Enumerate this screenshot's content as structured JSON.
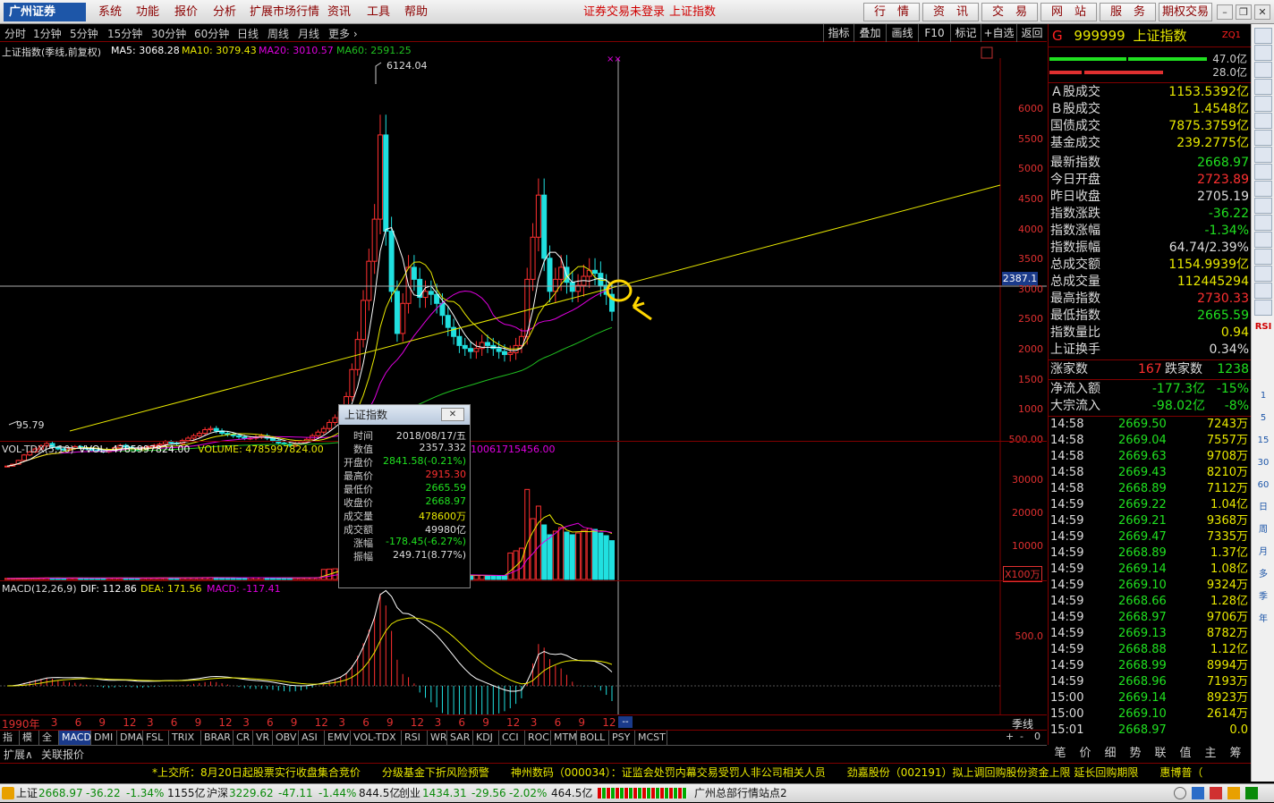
{
  "app": {
    "logo": "广州证券",
    "menu": [
      "系统",
      "功能",
      "报价",
      "分析",
      "扩展市场行情",
      "资讯",
      "工具",
      "帮助"
    ],
    "status_login": "证券交易未登录",
    "status_index": "上证指数",
    "top_buttons": [
      "行　情",
      "资　讯",
      "交　易",
      "网　站",
      "服　务",
      "期权交易"
    ]
  },
  "periods": [
    "分时",
    "1分钟",
    "5分钟",
    "15分钟",
    "30分钟",
    "60分钟",
    "日线",
    "周线",
    "月线",
    "更多 ›"
  ],
  "toolbar": [
    "指标",
    "叠加",
    "画线",
    "F10",
    "标记",
    "+自选",
    "返回"
  ],
  "main_chart": {
    "title": "上证指数(季线,前复权)",
    "ma5": "MA5: 3068.28",
    "ma10": "MA10: 3079.43",
    "ma20": "MA20: 3010.57",
    "ma60": "MA60: 2591.25",
    "high_label": "6124.04",
    "low_label": "95.79",
    "crosshair_value": "2387.1",
    "y_ticks": [
      "6000",
      "5500",
      "5000",
      "4500",
      "4000",
      "3500",
      "3000",
      "2500",
      "2000",
      "1500",
      "1000",
      "500.00"
    ]
  },
  "vol_panel": {
    "title": "VOL-TDX(5,10)",
    "vvol": "VVOL: 4785997824.00",
    "volume": "VOLUME: 4785997824.00",
    "extra": "10061715456.00",
    "y_ticks": [
      "30000",
      "20000",
      "10000"
    ],
    "unit": "X100万"
  },
  "macd_panel": {
    "title": "MACD(12,26,9)",
    "dif": "DIF: 112.86",
    "dea": "DEA: 171.56",
    "macd": "MACD: -117.41",
    "y_ticks": [
      "500.0"
    ]
  },
  "x_axis": {
    "labels": [
      "1990年",
      "3",
      "6",
      "9",
      "12",
      "3",
      "6",
      "9",
      "12",
      "3",
      "6",
      "9",
      "12",
      "3",
      "6",
      "9",
      "12",
      "3",
      "6",
      "9",
      "12",
      "3",
      "6",
      "9",
      "12",
      "3"
    ],
    "period": "季线"
  },
  "popup": {
    "title": "上证指数",
    "rows": [
      {
        "k": "时间",
        "v": "2018/08/17/五",
        "c": "#ddd"
      },
      {
        "k": "数值",
        "v": "2357.332",
        "c": "#ddd"
      },
      {
        "k": "开盘价",
        "v": "2841.58(-0.21%)",
        "c": "#20e020"
      },
      {
        "k": "最高价",
        "v": "2915.30",
        "c": "#ff3030"
      },
      {
        "k": "最低价",
        "v": "2665.59",
        "c": "#20e020"
      },
      {
        "k": "收盘价",
        "v": "2668.97",
        "c": "#20e020"
      },
      {
        "k": "成交量",
        "v": "478600万",
        "c": "#e8e800"
      },
      {
        "k": "成交额",
        "v": "49980亿",
        "c": "#ddd"
      },
      {
        "k": "涨幅",
        "v": "-178.45(-6.27%)",
        "c": "#20e020"
      },
      {
        "k": "振幅",
        "v": "249.71(8.77%)",
        "c": "#ddd"
      }
    ]
  },
  "indicator_tabs": [
    "指标",
    "模板",
    "全部",
    "MACD",
    "DMI",
    "DMA",
    "FSL",
    "TRIX",
    "BRAR",
    "CR",
    "VR",
    "OBV",
    "ASI",
    "EMV",
    "VOL-TDX",
    "RSI",
    "WR",
    "SAR",
    "KDJ",
    "CCI",
    "ROC",
    "MTM",
    "BOLL",
    "PSY",
    "MCST"
  ],
  "bottom_row": [
    "扩展∧",
    "关联报价"
  ],
  "right_panel": {
    "g": "G",
    "code": "999999",
    "name": "上证指数",
    "zq": "ZQ1",
    "bar_vals": [
      "47.0亿",
      "28.0亿"
    ],
    "stats": [
      {
        "k": "Ａ股成交",
        "v": "1153.5392亿",
        "c": "#e8e800"
      },
      {
        "k": "Ｂ股成交",
        "v": "1.4548亿",
        "c": "#e8e800"
      },
      {
        "k": "国债成交",
        "v": "7875.3759亿",
        "c": "#e8e800"
      },
      {
        "k": "基金成交",
        "v": "239.2775亿",
        "c": "#e8e800"
      },
      {
        "k": "最新指数",
        "v": "2668.97",
        "c": "#20e020"
      },
      {
        "k": "今日开盘",
        "v": "2723.89",
        "c": "#ff3030"
      },
      {
        "k": "昨日收盘",
        "v": "2705.19",
        "c": "#ddd"
      },
      {
        "k": "指数涨跌",
        "v": "-36.22",
        "c": "#20e020"
      },
      {
        "k": "指数涨幅",
        "v": "-1.34%",
        "c": "#20e020"
      },
      {
        "k": "指数振幅",
        "v": "64.74/2.39%",
        "c": "#ddd"
      },
      {
        "k": "总成交额",
        "v": "1154.9939亿",
        "c": "#e8e800"
      },
      {
        "k": "总成交量",
        "v": "112445294",
        "c": "#e8e800"
      },
      {
        "k": "最高指数",
        "v": "2730.33",
        "c": "#ff3030"
      },
      {
        "k": "最低指数",
        "v": "2665.59",
        "c": "#20e020"
      },
      {
        "k": "指数量比",
        "v": "0.94",
        "c": "#e8e800"
      },
      {
        "k": "上证换手",
        "v": "0.34%",
        "c": "#ddd"
      }
    ],
    "updown": {
      "k1": "涨家数",
      "v1": "167",
      "k2": "跌家数",
      "v2": "1238"
    },
    "flow": [
      {
        "k": "净流入额",
        "v": "-177.3亿",
        "p": "-15%"
      },
      {
        "k": "大宗流入",
        "v": "-98.02亿",
        "p": "-8%"
      }
    ],
    "ticks": [
      {
        "t": "14:58",
        "p": "2669.50",
        "q": "7243万"
      },
      {
        "t": "14:58",
        "p": "2669.04",
        "q": "7557万"
      },
      {
        "t": "14:58",
        "p": "2669.63",
        "q": "9708万"
      },
      {
        "t": "14:58",
        "p": "2669.43",
        "q": "8210万"
      },
      {
        "t": "14:58",
        "p": "2668.89",
        "q": "7112万"
      },
      {
        "t": "14:59",
        "p": "2669.22",
        "q": "1.04亿"
      },
      {
        "t": "14:59",
        "p": "2669.21",
        "q": "9368万"
      },
      {
        "t": "14:59",
        "p": "2669.47",
        "q": "7335万"
      },
      {
        "t": "14:59",
        "p": "2668.89",
        "q": "1.37亿"
      },
      {
        "t": "14:59",
        "p": "2669.14",
        "q": "1.08亿"
      },
      {
        "t": "14:59",
        "p": "2669.10",
        "q": "9324万"
      },
      {
        "t": "14:59",
        "p": "2668.66",
        "q": "1.28亿"
      },
      {
        "t": "14:59",
        "p": "2668.97",
        "q": "9706万"
      },
      {
        "t": "14:59",
        "p": "2669.13",
        "q": "8782万"
      },
      {
        "t": "14:59",
        "p": "2668.88",
        "q": "1.12亿"
      },
      {
        "t": "14:59",
        "p": "2668.99",
        "q": "8994万"
      },
      {
        "t": "14:59",
        "p": "2668.96",
        "q": "7193万"
      },
      {
        "t": "15:00",
        "p": "2669.14",
        "q": "8923万"
      },
      {
        "t": "15:00",
        "p": "2669.10",
        "q": "2614万"
      },
      {
        "t": "15:01",
        "p": "2668.97",
        "q": "0.0"
      }
    ],
    "tabs": [
      "笔",
      "价",
      "细",
      "势",
      "联",
      "值",
      "主",
      "筹"
    ]
  },
  "sidebar_labels": [
    "RSI",
    "1",
    "5",
    "15",
    "30",
    "60",
    "日",
    "周",
    "月",
    "多",
    "季",
    "年"
  ],
  "news": "*上交所：8月20日起股票实行收盘集合竞价　　分级基金下折风险预警　　神州数码（000034）：证监会处罚内幕交易受罚人非公司相关人员　　劲嘉股份（002191）拟上调回购股份资金上限 延长回购期限　　惠博普（",
  "statusbar": {
    "sh_name": "上证",
    "sh_val": "2668.97",
    "sh_chg": "-36.22",
    "sh_pct": "-1.34%",
    "sh_amt": "1155亿",
    "sz_name": "沪深",
    "sz_val": "3229.62",
    "sz_chg": "-47.11",
    "sz_pct": "-1.44%",
    "sz_amt": "844.5亿",
    "cy_name": "创业",
    "cy_val": "1434.31",
    "cy_chg": "-29.56",
    "cy_pct": "-2.02%",
    "cy_amt": "464.5亿",
    "station": "广州总部行情站点2"
  },
  "colors": {
    "up": "#ff3030",
    "down": "#20e0e0",
    "ma5": "#ffffff",
    "ma10": "#e8e800",
    "ma20": "#e000e0",
    "ma60": "#20c020",
    "trend": "#e8e800",
    "annotation": "#ffd700"
  }
}
